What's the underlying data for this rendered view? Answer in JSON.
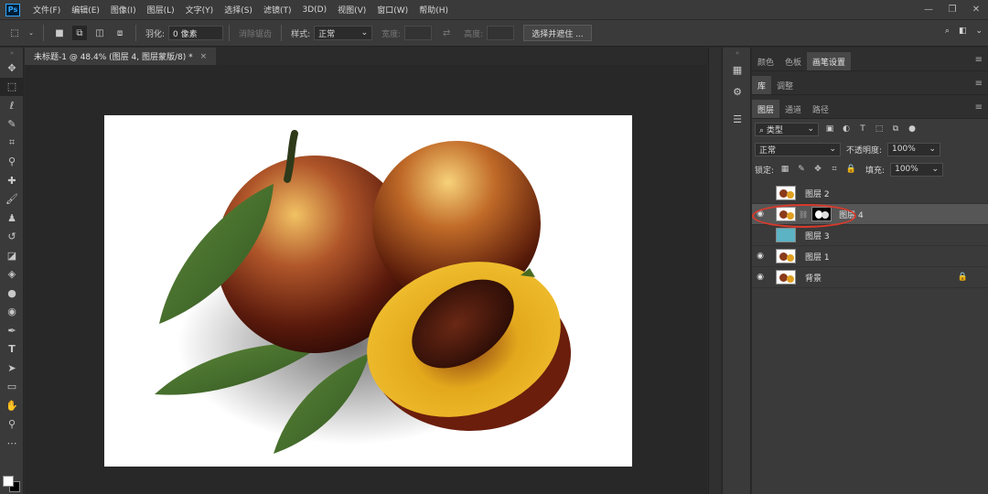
{
  "app": {
    "logo": "Ps"
  },
  "menu": [
    "文件(F)",
    "编辑(E)",
    "图像(I)",
    "图层(L)",
    "文字(Y)",
    "选择(S)",
    "滤镜(T)",
    "3D(D)",
    "视图(V)",
    "窗口(W)",
    "帮助(H)"
  ],
  "options": {
    "feather_label": "羽化:",
    "feather_value": "0 像素",
    "antialias_label": "消除锯齿",
    "style_label": "样式:",
    "style_value": "正常",
    "width_label": "宽度:",
    "height_label": "高度:",
    "select_mask_button": "选择并遮住 ..."
  },
  "document": {
    "tab_title": "未标题-1 @ 48.4% (图层 4, 图层蒙版/8) *",
    "close": "×"
  },
  "panel_tabs_1": [
    "颜色",
    "色板",
    "画笔设置"
  ],
  "panel_tabs_2": [
    "库",
    "调整"
  ],
  "panel_tabs_3": [
    "图层",
    "通道",
    "路径"
  ],
  "layers_panel": {
    "filter_kind": "类型",
    "blend_mode": "正常",
    "opacity_label": "不透明度:",
    "opacity_value": "100%",
    "lock_label": "锁定:",
    "fill_label": "填充:",
    "fill_value": "100%"
  },
  "layers": [
    {
      "name": "图层 2",
      "visible": false,
      "thumb": "peaches"
    },
    {
      "name": "图层 4",
      "visible": true,
      "thumb": "peaches",
      "mask": true,
      "selected": true
    },
    {
      "name": "图层 3",
      "visible": false,
      "thumb": "teal"
    },
    {
      "name": "图层 1",
      "visible": true,
      "thumb": "peaches"
    },
    {
      "name": "背景",
      "visible": true,
      "thumb": "peaches",
      "locked": true
    }
  ],
  "colors": {
    "annotation": "#d93a2b",
    "teal": "#5cb3c4"
  }
}
